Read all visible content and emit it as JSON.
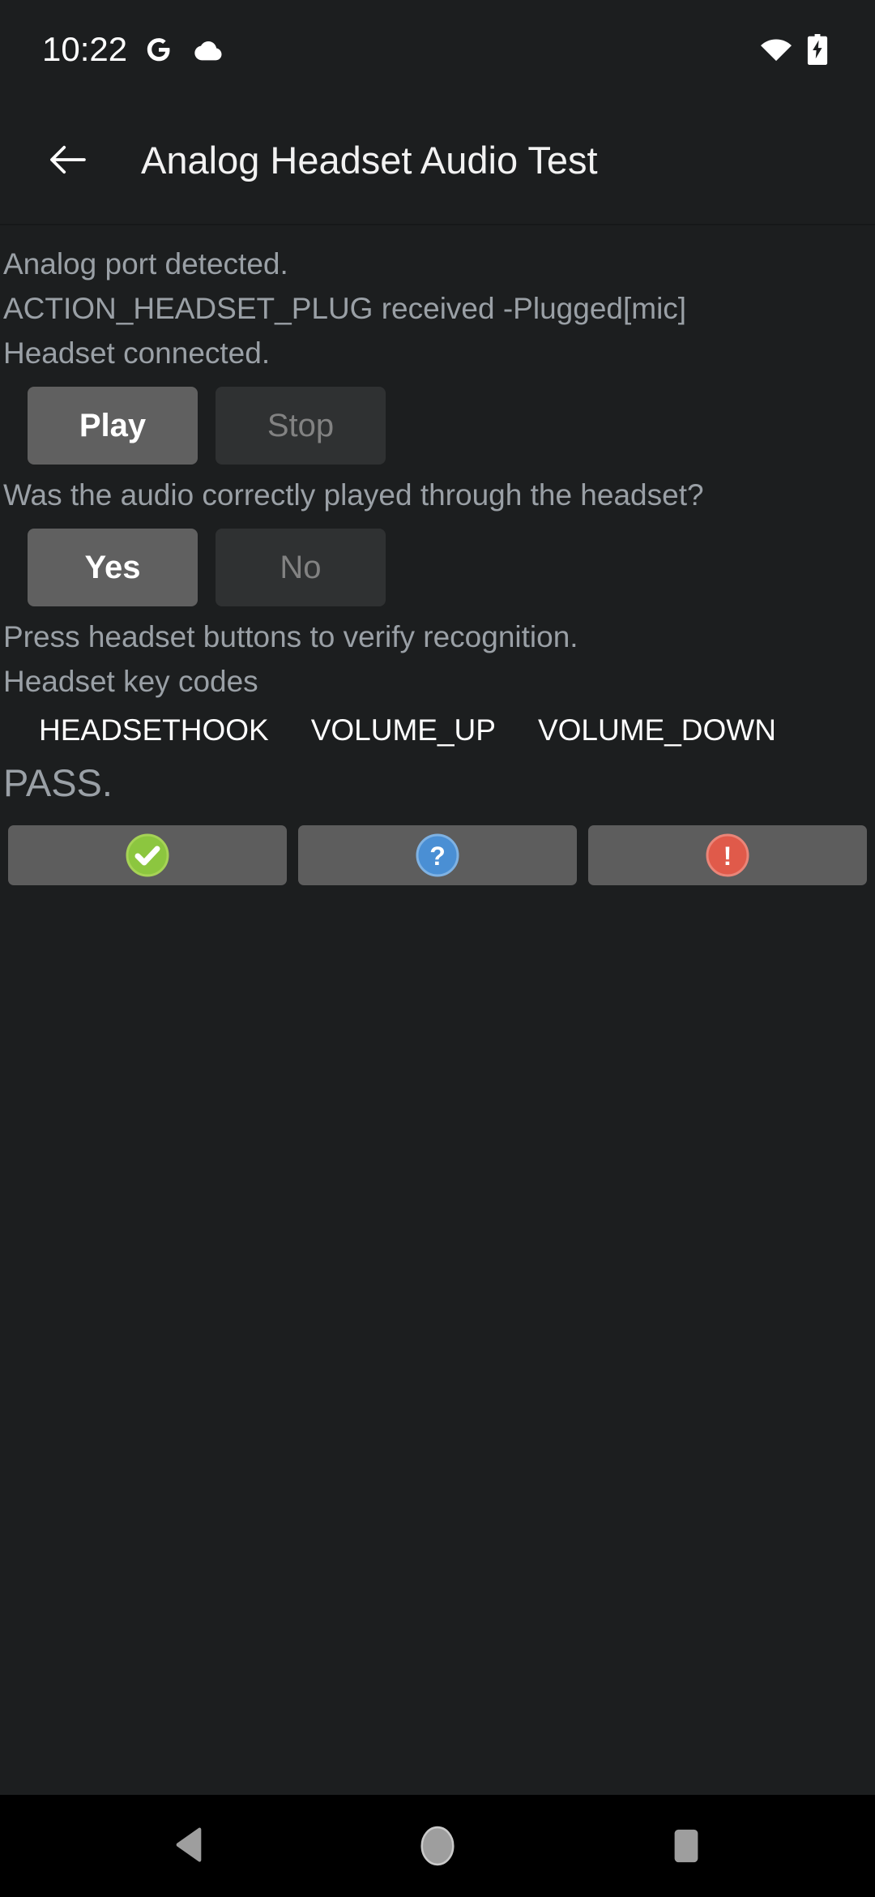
{
  "status_bar": {
    "clock": "10:22",
    "left_icons": [
      {
        "name": "google-icon",
        "label": "G"
      },
      {
        "name": "cloud-icon",
        "label": "cloud"
      }
    ],
    "right_icons": [
      {
        "name": "wifi-icon",
        "label": "wifi"
      },
      {
        "name": "battery-charging-icon",
        "label": "battery charging"
      }
    ]
  },
  "app_bar": {
    "back_label": "back-arrow",
    "title": "Analog Headset Audio Test"
  },
  "content": {
    "status_lines": [
      "Analog port detected.",
      "ACTION_HEADSET_PLUG received -Plugged[mic]",
      "Headset connected."
    ],
    "playback_controls": [
      {
        "label": "Play",
        "enabled": true
      },
      {
        "label": "Stop",
        "enabled": false
      }
    ],
    "audio_question": "Was the audio correctly played through the headset?",
    "answer_controls": [
      {
        "label": "Yes",
        "enabled": true
      },
      {
        "label": "No",
        "enabled": false
      }
    ],
    "press_instruction": "Press headset buttons to verify recognition.",
    "keycodes_label": "Headset key codes",
    "keycodes": [
      "HEADSETHOOK",
      "VOLUME_UP",
      "VOLUME_DOWN"
    ],
    "verdict": "PASS."
  },
  "action_bar": {
    "buttons": [
      {
        "name": "pass-button",
        "icon": "check-circle-icon",
        "color": "#8cc540"
      },
      {
        "name": "info-button",
        "icon": "question-circle-icon",
        "color": "#4a8fd4"
      },
      {
        "name": "fail-button",
        "icon": "exclamation-circle-icon",
        "color": "#e05a4a"
      }
    ]
  },
  "nav_bar": {
    "keys": [
      {
        "name": "nav-back-button",
        "icon": "triangle-left-icon"
      },
      {
        "name": "nav-home-button",
        "icon": "circle-icon"
      },
      {
        "name": "nav-recents-button",
        "icon": "square-icon"
      }
    ]
  },
  "colors": {
    "background": "#1c1e1f",
    "app_bar": "#1c1e1f",
    "body_text": "#9aa0a6",
    "keycode_text": "#ffffff",
    "button_enabled": "#606060",
    "button_disabled": "#2f3132",
    "action_button": "#5d5d5d",
    "nav_bar": "#000000"
  }
}
